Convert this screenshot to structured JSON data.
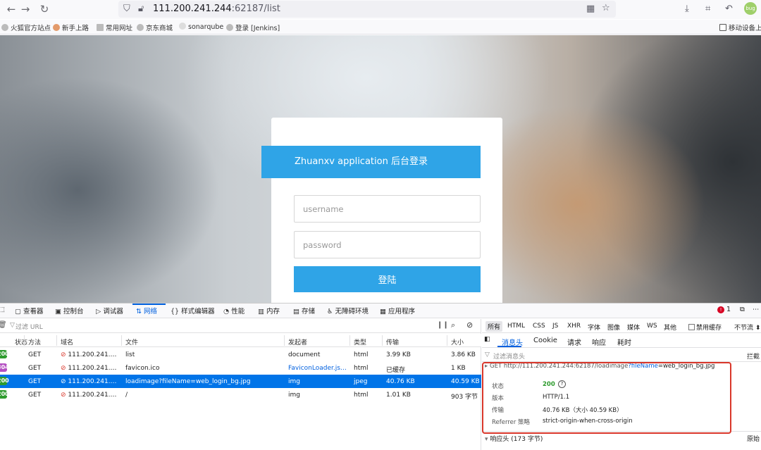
{
  "browser": {
    "url_host": "111.200.241.244",
    "url_rest": ":62187/list",
    "bookmarks": [
      "火狐官方站点",
      "新手上路",
      "常用网址",
      "京东商城",
      "sonarqube",
      "登录 [Jenkins]"
    ],
    "mobile_bookmarks": "移动设备上的"
  },
  "login": {
    "title": "Zhuanxv application 后台登录",
    "username_placeholder": "username",
    "password_placeholder": "password",
    "submit_label": "登陆"
  },
  "devtools": {
    "tabs": [
      "查看器",
      "控制台",
      "调试器",
      "网络",
      "样式编辑器",
      "性能",
      "内存",
      "存储",
      "无障碍环境",
      "应用程序"
    ],
    "active_tab": "网络",
    "error_count": "1",
    "filter_placeholder": "过滤 URL",
    "columns": [
      "状态",
      "方法",
      "域名",
      "文件",
      "发起者",
      "类型",
      "传输",
      "大小"
    ],
    "requests": [
      {
        "status": "200",
        "method": "GET",
        "domain": "111.200.241.244...",
        "file": "list",
        "initiator": "document",
        "type": "html",
        "transfer": "3.99 KB",
        "size": "3.86 KB",
        "selected": false
      },
      {
        "status": "304",
        "method": "GET",
        "domain": "111.200.241.244...",
        "file": "favicon.ico",
        "initiator": "FaviconLoader.jsm...",
        "type": "html",
        "transfer": "已缓存",
        "size": "1 KB",
        "selected": false
      },
      {
        "status": "200",
        "method": "GET",
        "domain": "111.200.241.244...",
        "file": "loadimage?fileName=web_login_bg.jpg",
        "initiator": "img",
        "type": "jpeg",
        "transfer": "40.76 KB",
        "size": "40.59 KB",
        "selected": true
      },
      {
        "status": "200",
        "method": "GET",
        "domain": "111.200.241.244...",
        "file": "/",
        "initiator": "img",
        "type": "html",
        "transfer": "1.01 KB",
        "size": "903 字节",
        "selected": false
      }
    ],
    "type_filters": [
      "所有",
      "HTML",
      "CSS",
      "JS",
      "XHR",
      "字体",
      "图像",
      "媒体",
      "WS",
      "其他"
    ],
    "disable_cache_label": "禁用缓存",
    "throttle_label": "不节流",
    "detail_tabs": [
      "消息头",
      "Cookie",
      "请求",
      "响应",
      "耗时"
    ],
    "header_filter_placeholder": "过滤消息头",
    "block_label": "拦截",
    "summary": {
      "method": "GET",
      "url_base": "http://111.200.241.244:62187/loadimage",
      "url_param": "?fileName",
      "url_value": "=web_login_bg.jpg",
      "status_label": "状态",
      "status_value": "200",
      "version_label": "版本",
      "version_value": "HTTP/1.1",
      "transfer_label": "传输",
      "transfer_value": "40.76 KB（大小 40.59 KB）",
      "referrer_label": "Referrer 策略",
      "referrer_value": "strict-origin-when-cross-origin"
    },
    "response_headers_label": "响应头 (173 字节)",
    "raw_label": "原始"
  },
  "colors": {
    "accent": "#2fa4e7",
    "selected_row": "#0074e8",
    "status_ok": "#2e9b2e",
    "status_cached": "#b44fc2",
    "highlight": "#d9372b"
  }
}
